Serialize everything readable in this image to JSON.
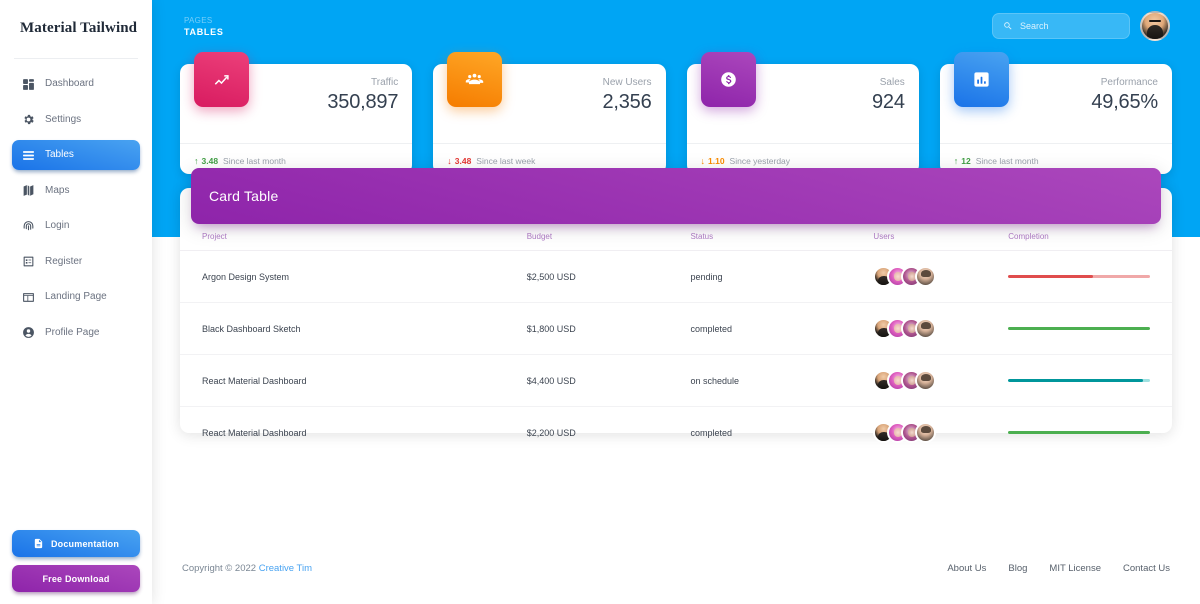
{
  "brand": {
    "name": "Material Tailwind"
  },
  "sidebar": {
    "items": [
      {
        "label": "Dashboard",
        "icon": "dashboard-icon",
        "active": false
      },
      {
        "label": "Settings",
        "icon": "gear-icon",
        "active": false
      },
      {
        "label": "Tables",
        "icon": "table-rows-icon",
        "active": true
      },
      {
        "label": "Maps",
        "icon": "map-icon",
        "active": false
      },
      {
        "label": "Login",
        "icon": "fingerprint-icon",
        "active": false
      },
      {
        "label": "Register",
        "icon": "form-icon",
        "active": false
      },
      {
        "label": "Landing Page",
        "icon": "layout-icon",
        "active": false
      },
      {
        "label": "Profile Page",
        "icon": "person-icon",
        "active": false
      }
    ],
    "documentation_label": "Documentation",
    "free_download_label": "Free Download"
  },
  "navbar": {
    "breadcrumb_parent": "PAGES",
    "page_title": "TABLES",
    "search_placeholder": "Search",
    "search_value": ""
  },
  "stats": [
    {
      "label": "Traffic",
      "value": "350,897",
      "delta": "3.48",
      "delta_direction": "up",
      "delta_color": "#43a047",
      "period": "Since last month",
      "icon": "trending-up-icon",
      "gradient_from": "#EC407A",
      "gradient_to": "#D81B60"
    },
    {
      "label": "New Users",
      "value": "2,356",
      "delta": "3.48",
      "delta_direction": "down",
      "delta_color": "#e53935",
      "period": "Since last week",
      "icon": "group-icon",
      "gradient_from": "#FFA726",
      "gradient_to": "#F57C00"
    },
    {
      "label": "Sales",
      "value": "924",
      "delta": "1.10",
      "delta_direction": "down",
      "delta_color": "#fb8c00",
      "period": "Since yesterday",
      "icon": "dollar-circle-icon",
      "gradient_from": "#AB47BC",
      "gradient_to": "#8E24AA"
    },
    {
      "label": "Performance",
      "value": "49,65%",
      "delta": "12",
      "delta_direction": "up",
      "delta_color": "#43a047",
      "period": "Since last month",
      "icon": "bar-chart-icon",
      "gradient_from": "#49a3f1",
      "gradient_to": "#1A73E8"
    }
  ],
  "card_table": {
    "title": "Card Table",
    "columns": [
      "Project",
      "Budget",
      "Status",
      "Users",
      "Completion"
    ],
    "rows": [
      {
        "project": "Argon Design System",
        "budget": "$2,500 USD",
        "status": "pending",
        "completion_percent": 60,
        "bar_color": "#e04d4d",
        "bar_track": "#f0a8a8",
        "avatars": [
          "avatar-1",
          "avatar-2",
          "avatar-3",
          "avatar-4"
        ]
      },
      {
        "project": "Black Dashboard Sketch",
        "budget": "$1,800 USD",
        "status": "completed",
        "completion_percent": 100,
        "bar_color": "#4caf50",
        "bar_track": "#a5d6a7",
        "avatars": [
          "avatar-1",
          "avatar-2",
          "avatar-3",
          "avatar-4"
        ]
      },
      {
        "project": "React Material Dashboard",
        "budget": "$4,400 USD",
        "status": "on schedule",
        "completion_percent": 95,
        "bar_color": "#00969b",
        "bar_track": "#9fe0e0",
        "avatars": [
          "avatar-1",
          "avatar-2",
          "avatar-3",
          "avatar-4"
        ]
      },
      {
        "project": "React Material Dashboard",
        "budget": "$2,200 USD",
        "status": "completed",
        "completion_percent": 100,
        "bar_color": "#4caf50",
        "bar_track": "#a5d6a7",
        "avatars": [
          "avatar-1",
          "avatar-2",
          "avatar-3",
          "avatar-4"
        ]
      }
    ]
  },
  "footer": {
    "copyright_prefix": "Copyright © 2022",
    "copyright_link": "Creative Tim",
    "links": [
      "About Us",
      "Blog",
      "MIT License",
      "Contact Us"
    ]
  },
  "colors": {
    "page_blue": "#00A5F4",
    "accent_purple": "#8e24aa",
    "accent_blue": "#1A73E8"
  }
}
